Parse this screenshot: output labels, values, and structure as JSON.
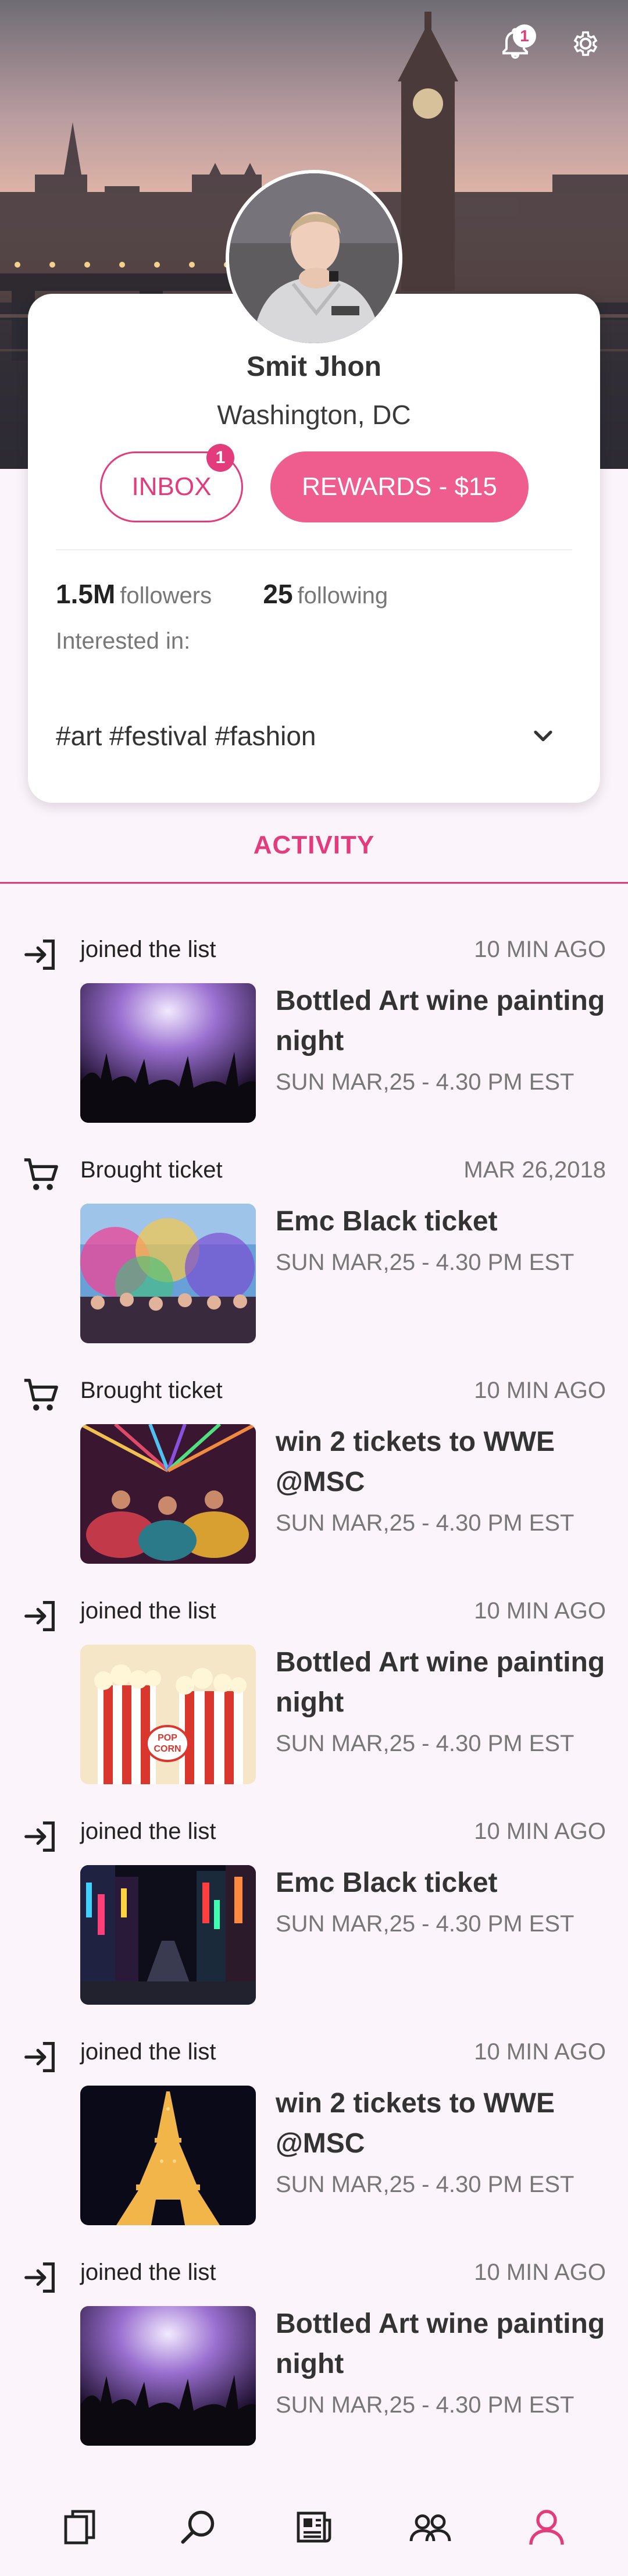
{
  "header": {
    "notification_count": "1"
  },
  "profile": {
    "name": "Smit Jhon",
    "location": "Washington, DC",
    "inbox_label": "INBOX",
    "inbox_count": "1",
    "rewards_label": "REWARDS - $15",
    "followers_count": "1.5M",
    "followers_label": "followers",
    "following_count": "25",
    "following_label": "following",
    "interested_label": "Interested in:",
    "tags": "#art #festival #fashion"
  },
  "activity": {
    "tab_label": "ACTIVITY",
    "items": [
      {
        "icon": "login-icon",
        "action": "joined the list",
        "time": "10 MIN AGO",
        "title": "Bottled Art wine painting night",
        "date": "SUN MAR,25 - 4.30 PM EST",
        "image": "concert-crowd"
      },
      {
        "icon": "cart-icon",
        "action": "Brought ticket",
        "time": "MAR 26,2018",
        "title": "Emc Black ticket",
        "date": "SUN MAR,25 - 4.30 PM EST",
        "image": "color-festival"
      },
      {
        "icon": "cart-icon",
        "action": "Brought ticket",
        "time": "10 MIN AGO",
        "title": "win 2 tickets to WWE @MSC",
        "date": "SUN MAR,25 - 4.30 PM EST",
        "image": "folk-dancers"
      },
      {
        "icon": "login-icon",
        "action": "joined the list",
        "time": "10 MIN AGO",
        "title": "Bottled Art wine painting night",
        "date": "SUN MAR,25 - 4.30 PM EST",
        "image": "popcorn"
      },
      {
        "icon": "login-icon",
        "action": "joined the list",
        "time": "10 MIN AGO",
        "title": "Emc Black ticket",
        "date": "SUN MAR,25 - 4.30 PM EST",
        "image": "city-night-street"
      },
      {
        "icon": "login-icon",
        "action": "joined the list",
        "time": "10 MIN AGO",
        "title": "win 2 tickets to WWE @MSC",
        "date": "SUN MAR,25 - 4.30 PM EST",
        "image": "eiffel-tower"
      },
      {
        "icon": "login-icon",
        "action": "joined the list",
        "time": "10 MIN AGO",
        "title": "Bottled Art wine painting night",
        "date": "SUN MAR,25 - 4.30 PM EST",
        "image": "concert-crowd"
      }
    ]
  },
  "bottom_nav": {
    "items": [
      "cards-icon",
      "search-icon",
      "news-icon",
      "people-icon",
      "profile-icon"
    ],
    "active": "profile-icon"
  },
  "colors": {
    "accent": "#e23c7d",
    "accent_light": "#ef5d8f",
    "background": "#fcf4fb"
  }
}
